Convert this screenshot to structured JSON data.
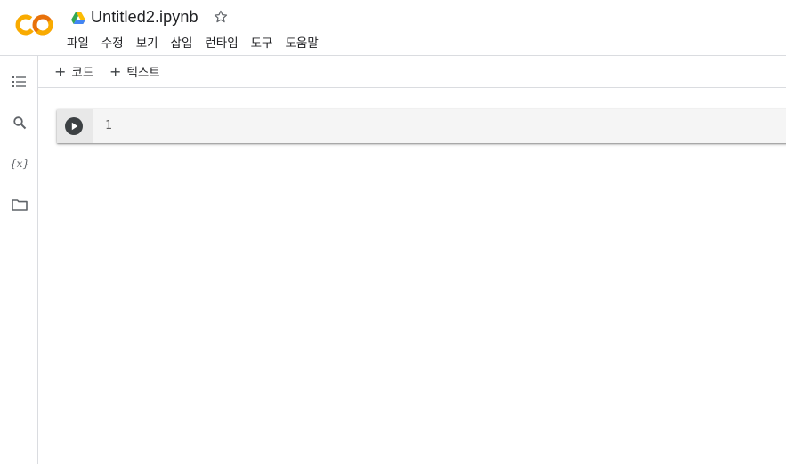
{
  "header": {
    "file_title": "Untitled2.ipynb",
    "menu": [
      "파일",
      "수정",
      "보기",
      "삽입",
      "런타임",
      "도구",
      "도움말"
    ]
  },
  "icons": {
    "logo": "colab-logo",
    "drive": "google-drive-icon",
    "star": "star-outline-icon",
    "rail": [
      "table-of-contents-icon",
      "search-icon",
      "variables-icon",
      "folder-icon"
    ],
    "run": "play-circle-icon"
  },
  "rail": {
    "variables_label": "{x}"
  },
  "toolbar": {
    "add_code_plus": "+",
    "add_code_label": "코드",
    "add_text_plus": "+",
    "add_text_label": "텍스트"
  },
  "cell": {
    "line_number": "1"
  },
  "colors": {
    "logo_orange": "#F9AB00",
    "logo_dark_orange": "#E8710A",
    "border": "#dadce0",
    "cell_bg": "#f5f5f5"
  }
}
